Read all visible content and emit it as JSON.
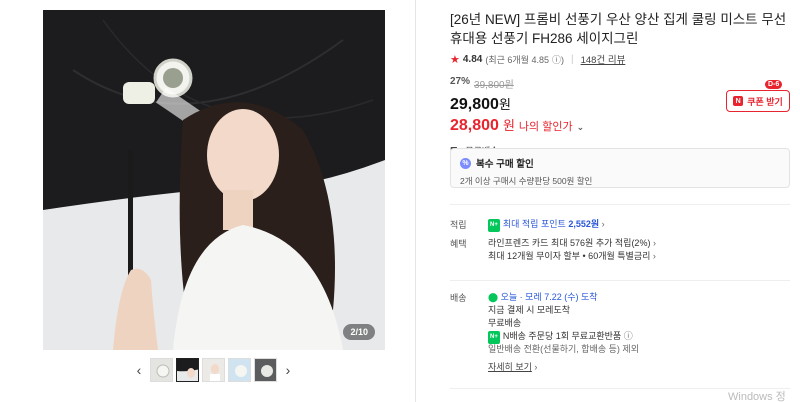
{
  "gallery": {
    "counter": "2/10",
    "prev_icon": "chevron-left-icon",
    "next_icon": "chevron-right-icon"
  },
  "product": {
    "title": "[26년 NEW] 프롬비 선풍기 우산 양산 집게 쿨링 미스트 무선 휴대용 선풍기 FH286 세이지그린",
    "rating": "4.84",
    "rating_sub": "(최근 6개월 4.85",
    "reviews": "148건 리뷰",
    "discount_rate": "27%",
    "original_price": "39,800원",
    "price": "29,800",
    "price_unit": "원",
    "my_price": "28,800",
    "my_price_unit": "원",
    "my_price_label": "나의 할인가",
    "coupon_label": "쿠폰 받기",
    "coupon_badge": "D-6",
    "shipping_free": "무료배송"
  },
  "bulk": {
    "title": "복수 구매 할인",
    "desc": "2개 이상 구매시 수량판당 500원 할인"
  },
  "benefits": {
    "label_points": "적립",
    "points_text": "최대 적립 포인트",
    "points_value": "2,552원",
    "label_perks": "혜택",
    "perk1": "라인프렌즈 카드 최대 576원 추가 적립(2%)",
    "perk2": "최대 12개월 무이자 할부 • 60개월 특별금리"
  },
  "delivery": {
    "label": "배송",
    "arrival": "오늘 · 모레 7.22 (수) 도착",
    "note1": "지금 결제 시 모레도착",
    "note2": "무료배송",
    "npay": "N배송 주문당 1회 무료교환반품",
    "note3": "일반배송 전환(선물하기, 합배송 등) 제외",
    "more": "자세히 보기"
  },
  "watermark": "Windows 정"
}
